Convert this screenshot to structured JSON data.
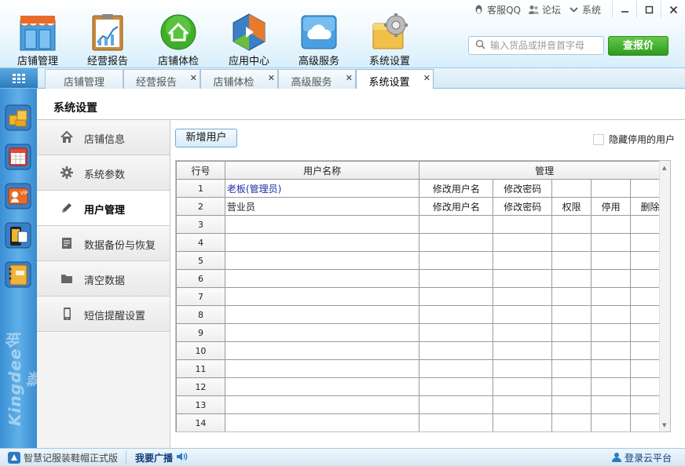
{
  "top_links": {
    "qq": "客服QQ",
    "forum": "论坛",
    "system": "系统"
  },
  "nav": [
    {
      "label": "店铺管理"
    },
    {
      "label": "经营报告"
    },
    {
      "label": "店铺体检"
    },
    {
      "label": "应用中心"
    },
    {
      "label": "高级服务"
    },
    {
      "label": "系统设置"
    }
  ],
  "search": {
    "placeholder": "输入货品或拼音首字母"
  },
  "price_button": "查报价",
  "tabs": [
    {
      "label": "店铺管理",
      "closable": false
    },
    {
      "label": "经营报告",
      "closable": true
    },
    {
      "label": "店铺体检",
      "closable": true
    },
    {
      "label": "高级服务",
      "closable": true
    },
    {
      "label": "系统设置",
      "closable": true,
      "active": true
    }
  ],
  "brand": "Kingdee金蝶",
  "page_title": "系统设置",
  "menu": [
    {
      "label": "店铺信息",
      "icon": "house-icon"
    },
    {
      "label": "系统参数",
      "icon": "gear-icon"
    },
    {
      "label": "用户管理",
      "icon": "pencil-icon",
      "active": true
    },
    {
      "label": "数据备份与恢复",
      "icon": "document-icon"
    },
    {
      "label": "清空数据",
      "icon": "folder-icon"
    },
    {
      "label": "短信提醒设置",
      "icon": "phone-icon"
    }
  ],
  "add_user_button": "新增用户",
  "hide_disabled_label": "隐藏停用的用户",
  "grid": {
    "headers": {
      "row_no": "行号",
      "username": "用户名称",
      "manage": "管理"
    },
    "rows": [
      {
        "no": "1",
        "name": "老板(管理员)",
        "actions": [
          "修改用户名",
          "修改密码",
          "",
          "",
          ""
        ]
      },
      {
        "no": "2",
        "name": "营业员",
        "actions": [
          "修改用户名",
          "修改密码",
          "权限",
          "停用",
          "删除"
        ]
      },
      {
        "no": "3",
        "name": "",
        "actions": [
          "",
          "",
          "",
          "",
          ""
        ]
      },
      {
        "no": "4",
        "name": "",
        "actions": [
          "",
          "",
          "",
          "",
          ""
        ]
      },
      {
        "no": "5",
        "name": "",
        "actions": [
          "",
          "",
          "",
          "",
          ""
        ]
      },
      {
        "no": "6",
        "name": "",
        "actions": [
          "",
          "",
          "",
          "",
          ""
        ]
      },
      {
        "no": "7",
        "name": "",
        "actions": [
          "",
          "",
          "",
          "",
          ""
        ]
      },
      {
        "no": "8",
        "name": "",
        "actions": [
          "",
          "",
          "",
          "",
          ""
        ]
      },
      {
        "no": "9",
        "name": "",
        "actions": [
          "",
          "",
          "",
          "",
          ""
        ]
      },
      {
        "no": "10",
        "name": "",
        "actions": [
          "",
          "",
          "",
          "",
          ""
        ]
      },
      {
        "no": "11",
        "name": "",
        "actions": [
          "",
          "",
          "",
          "",
          ""
        ]
      },
      {
        "no": "12",
        "name": "",
        "actions": [
          "",
          "",
          "",
          "",
          ""
        ]
      },
      {
        "no": "13",
        "name": "",
        "actions": [
          "",
          "",
          "",
          "",
          ""
        ]
      },
      {
        "no": "14",
        "name": "",
        "actions": [
          "",
          "",
          "",
          "",
          ""
        ]
      }
    ]
  },
  "status": {
    "app_name": "智慧记服装鞋帽正式版",
    "broadcast": "我要广播",
    "cloud_login": "登录云平台"
  },
  "colors": {
    "accent_blue": "#3a8bcf",
    "price_green": "#2e9b1d",
    "admin_name": "#1b2fa6"
  }
}
